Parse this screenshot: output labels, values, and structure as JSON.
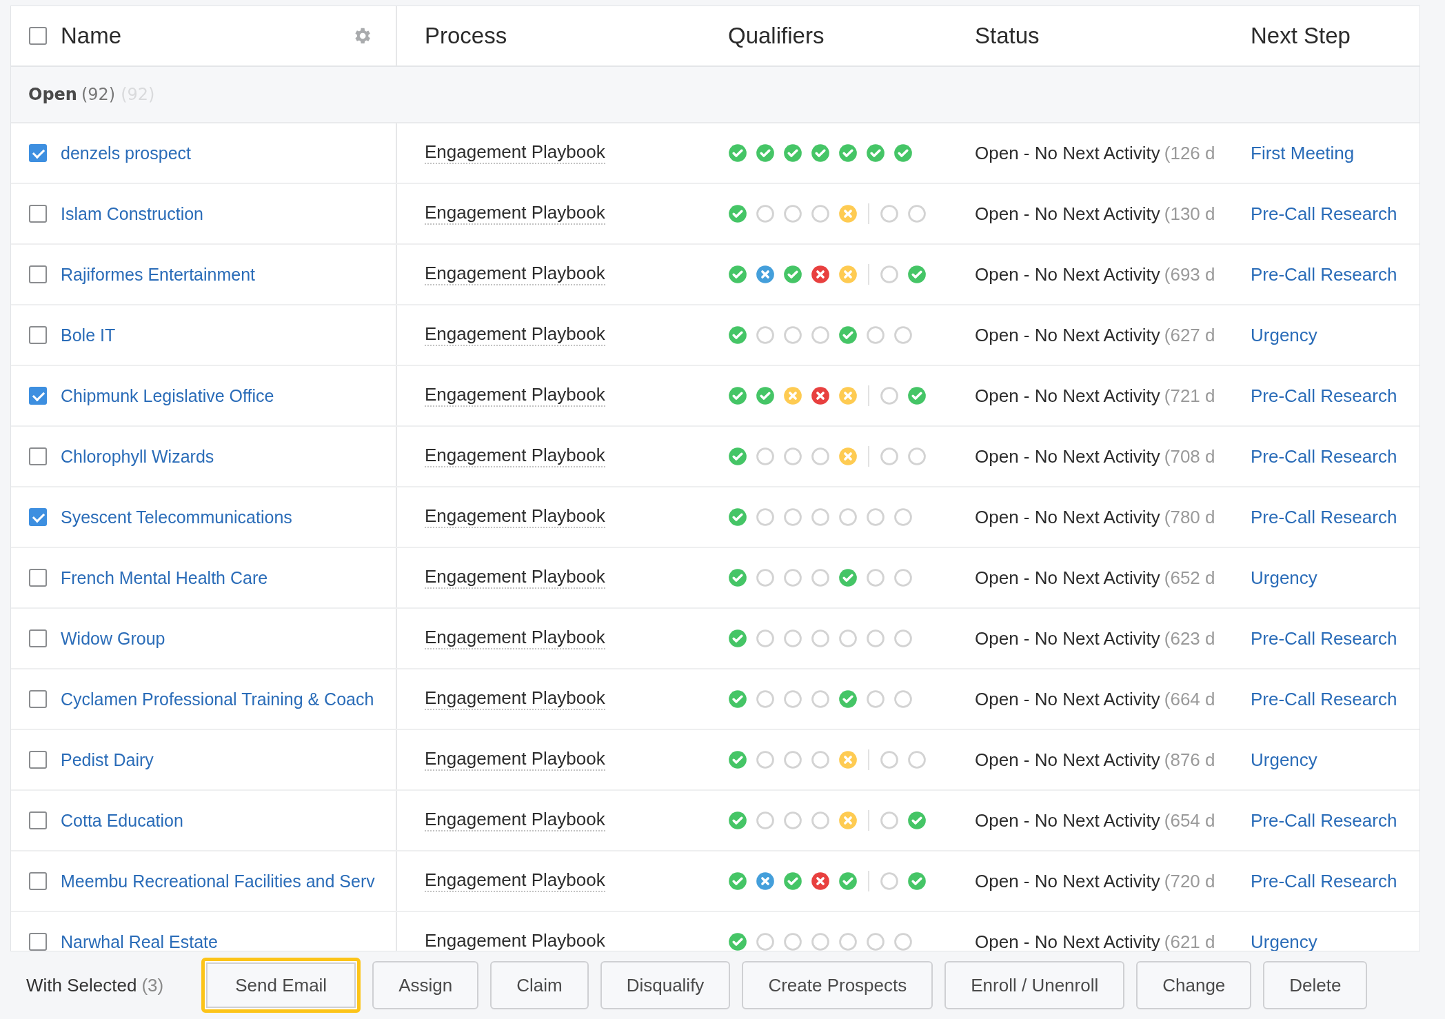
{
  "table": {
    "select_all": {
      "checked": false
    },
    "columns": [
      "Name",
      "Process",
      "Qualifiers",
      "Status",
      "Next Step"
    ],
    "group": {
      "label": "Open",
      "count": "(92)",
      "ghost_count": "(92)"
    },
    "rows": [
      {
        "name": "denzels prospect",
        "checked": true,
        "process": "Engagement Playbook",
        "qualifiers": [
          {
            "kind": "check"
          },
          {
            "kind": "check"
          },
          {
            "kind": "check"
          },
          {
            "kind": "check"
          },
          {
            "kind": "check"
          },
          {
            "kind": "check"
          },
          {
            "kind": "check"
          }
        ],
        "divider": false,
        "status": "Open - No Next Activity",
        "age": "(126 d",
        "next_step": "First Meeting"
      },
      {
        "name": "Islam Construction",
        "checked": false,
        "process": "Engagement Playbook",
        "qualifiers": [
          {
            "kind": "check"
          },
          {
            "kind": "empty"
          },
          {
            "kind": "empty"
          },
          {
            "kind": "empty"
          },
          {
            "kind": "amber"
          },
          {
            "kind": "empty"
          },
          {
            "kind": "empty"
          }
        ],
        "divider": true,
        "status": "Open - No Next Activity",
        "age": "(130 d",
        "next_step": "Pre-Call Research"
      },
      {
        "name": "Rajiformes Entertainment",
        "checked": false,
        "process": "Engagement Playbook",
        "qualifiers": [
          {
            "kind": "check"
          },
          {
            "kind": "blue"
          },
          {
            "kind": "check"
          },
          {
            "kind": "red"
          },
          {
            "kind": "amber"
          },
          {
            "kind": "empty"
          },
          {
            "kind": "check"
          }
        ],
        "divider": true,
        "status": "Open - No Next Activity",
        "age": "(693 d",
        "next_step": "Pre-Call Research"
      },
      {
        "name": "Bole IT",
        "checked": false,
        "process": "Engagement Playbook",
        "qualifiers": [
          {
            "kind": "check"
          },
          {
            "kind": "empty"
          },
          {
            "kind": "empty"
          },
          {
            "kind": "empty"
          },
          {
            "kind": "check"
          },
          {
            "kind": "empty"
          },
          {
            "kind": "empty"
          }
        ],
        "divider": false,
        "status": "Open - No Next Activity",
        "age": "(627 d",
        "next_step": "Urgency"
      },
      {
        "name": "Chipmunk Legislative Office",
        "checked": true,
        "process": "Engagement Playbook",
        "qualifiers": [
          {
            "kind": "check"
          },
          {
            "kind": "check"
          },
          {
            "kind": "amber"
          },
          {
            "kind": "red"
          },
          {
            "kind": "amber"
          },
          {
            "kind": "empty"
          },
          {
            "kind": "check"
          }
        ],
        "divider": true,
        "status": "Open - No Next Activity",
        "age": "(721 d",
        "next_step": "Pre-Call Research"
      },
      {
        "name": "Chlorophyll Wizards",
        "checked": false,
        "process": "Engagement Playbook",
        "qualifiers": [
          {
            "kind": "check"
          },
          {
            "kind": "empty"
          },
          {
            "kind": "empty"
          },
          {
            "kind": "empty"
          },
          {
            "kind": "amber"
          },
          {
            "kind": "empty"
          },
          {
            "kind": "empty"
          }
        ],
        "divider": true,
        "status": "Open - No Next Activity",
        "age": "(708 d",
        "next_step": "Pre-Call Research"
      },
      {
        "name": "Syescent Telecommunications",
        "checked": true,
        "process": "Engagement Playbook",
        "qualifiers": [
          {
            "kind": "check"
          },
          {
            "kind": "empty"
          },
          {
            "kind": "empty"
          },
          {
            "kind": "empty"
          },
          {
            "kind": "empty"
          },
          {
            "kind": "empty"
          },
          {
            "kind": "empty"
          }
        ],
        "divider": false,
        "status": "Open - No Next Activity",
        "age": "(780 d",
        "next_step": "Pre-Call Research"
      },
      {
        "name": "French Mental Health Care",
        "checked": false,
        "process": "Engagement Playbook",
        "qualifiers": [
          {
            "kind": "check"
          },
          {
            "kind": "empty"
          },
          {
            "kind": "empty"
          },
          {
            "kind": "empty"
          },
          {
            "kind": "check"
          },
          {
            "kind": "empty"
          },
          {
            "kind": "empty"
          }
        ],
        "divider": false,
        "status": "Open - No Next Activity",
        "age": "(652 d",
        "next_step": "Urgency"
      },
      {
        "name": "Widow Group",
        "checked": false,
        "process": "Engagement Playbook",
        "qualifiers": [
          {
            "kind": "check"
          },
          {
            "kind": "empty"
          },
          {
            "kind": "empty"
          },
          {
            "kind": "empty"
          },
          {
            "kind": "empty"
          },
          {
            "kind": "empty"
          },
          {
            "kind": "empty"
          }
        ],
        "divider": false,
        "status": "Open - No Next Activity",
        "age": "(623 d",
        "next_step": "Pre-Call Research"
      },
      {
        "name": "Cyclamen Professional Training & Coach",
        "checked": false,
        "process": "Engagement Playbook",
        "qualifiers": [
          {
            "kind": "check"
          },
          {
            "kind": "empty"
          },
          {
            "kind": "empty"
          },
          {
            "kind": "empty"
          },
          {
            "kind": "check"
          },
          {
            "kind": "empty"
          },
          {
            "kind": "empty"
          }
        ],
        "divider": false,
        "status": "Open - No Next Activity",
        "age": "(664 d",
        "next_step": "Pre-Call Research"
      },
      {
        "name": "Pedist Dairy",
        "checked": false,
        "process": "Engagement Playbook",
        "qualifiers": [
          {
            "kind": "check"
          },
          {
            "kind": "empty"
          },
          {
            "kind": "empty"
          },
          {
            "kind": "empty"
          },
          {
            "kind": "amber"
          },
          {
            "kind": "empty"
          },
          {
            "kind": "empty"
          }
        ],
        "divider": true,
        "status": "Open - No Next Activity",
        "age": "(876 d",
        "next_step": "Urgency"
      },
      {
        "name": "Cotta Education",
        "checked": false,
        "process": "Engagement Playbook",
        "qualifiers": [
          {
            "kind": "check"
          },
          {
            "kind": "empty"
          },
          {
            "kind": "empty"
          },
          {
            "kind": "empty"
          },
          {
            "kind": "amber"
          },
          {
            "kind": "empty"
          },
          {
            "kind": "check"
          }
        ],
        "divider": true,
        "status": "Open - No Next Activity",
        "age": "(654 d",
        "next_step": "Pre-Call Research"
      },
      {
        "name": "Meembu Recreational Facilities and Serv",
        "checked": false,
        "process": "Engagement Playbook",
        "qualifiers": [
          {
            "kind": "check"
          },
          {
            "kind": "blue"
          },
          {
            "kind": "check"
          },
          {
            "kind": "red"
          },
          {
            "kind": "check"
          },
          {
            "kind": "empty"
          },
          {
            "kind": "check"
          }
        ],
        "divider": true,
        "status": "Open - No Next Activity",
        "age": "(720 d",
        "next_step": "Pre-Call Research"
      },
      {
        "name": "Narwhal Real Estate",
        "checked": false,
        "process": "Engagement Playbook",
        "qualifiers": [
          {
            "kind": "check"
          },
          {
            "kind": "empty"
          },
          {
            "kind": "empty"
          },
          {
            "kind": "empty"
          },
          {
            "kind": "empty"
          },
          {
            "kind": "empty"
          },
          {
            "kind": "empty"
          }
        ],
        "divider": false,
        "status": "Open - No Next Activity",
        "age": "(621 d",
        "next_step": "Urgency"
      }
    ]
  },
  "action_bar": {
    "label": "With Selected",
    "count": "(3)",
    "buttons": [
      {
        "label": "Send Email",
        "focused": true
      },
      {
        "label": "Assign",
        "focused": false
      },
      {
        "label": "Claim",
        "focused": false
      },
      {
        "label": "Disqualify",
        "focused": false
      },
      {
        "label": "Create Prospects",
        "focused": false
      },
      {
        "label": "Enroll / Unenroll",
        "focused": false
      },
      {
        "label": "Change",
        "focused": false
      },
      {
        "label": "Delete",
        "focused": false
      }
    ]
  }
}
